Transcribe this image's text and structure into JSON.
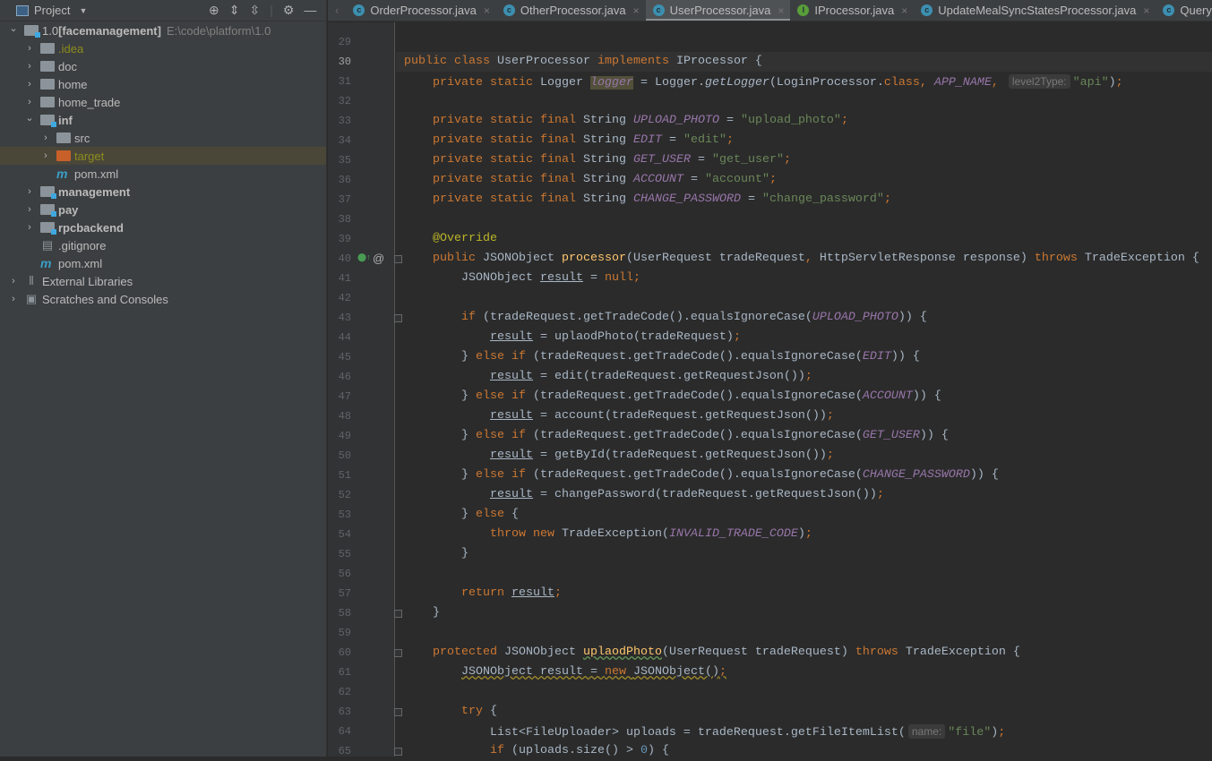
{
  "sidebar": {
    "title": "Project",
    "tree": [
      {
        "label": "1.0",
        "module": "[facemanagement]",
        "path": "E:\\code\\platform\\1.0",
        "depth": 0,
        "open": true,
        "icon": "module-folder"
      },
      {
        "label": ".idea",
        "depth": 1,
        "icon": "folder",
        "style": "olive"
      },
      {
        "label": "doc",
        "depth": 1,
        "icon": "folder"
      },
      {
        "label": "home",
        "depth": 1,
        "icon": "folder"
      },
      {
        "label": "home_trade",
        "depth": 1,
        "icon": "folder"
      },
      {
        "label": "inf",
        "depth": 1,
        "open": true,
        "icon": "module-folder",
        "style": "bold"
      },
      {
        "label": "src",
        "depth": 2,
        "icon": "folder"
      },
      {
        "label": "target",
        "depth": 2,
        "icon": "excluded-folder",
        "style": "olive",
        "selected": true
      },
      {
        "label": "pom.xml",
        "depth": 2,
        "icon": "maven",
        "leaf": true
      },
      {
        "label": "management",
        "depth": 1,
        "icon": "module-folder",
        "style": "bold"
      },
      {
        "label": "pay",
        "depth": 1,
        "icon": "module-folder",
        "style": "bold"
      },
      {
        "label": "rpcbackend",
        "depth": 1,
        "icon": "module-folder",
        "style": "bold"
      },
      {
        "label": ".gitignore",
        "depth": 1,
        "icon": "ignored-file",
        "leaf": true
      },
      {
        "label": "pom.xml",
        "depth": 1,
        "icon": "maven",
        "leaf": true
      },
      {
        "label": "External Libraries",
        "depth": 0,
        "icon": "libraries"
      },
      {
        "label": "Scratches and Consoles",
        "depth": 0,
        "icon": "scratches"
      }
    ]
  },
  "tabs": [
    {
      "label": "OrderProcessor.java",
      "icon": "class"
    },
    {
      "label": "OtherProcessor.java",
      "icon": "class"
    },
    {
      "label": "UserProcessor.java",
      "icon": "class",
      "active": true
    },
    {
      "label": "IProcessor.java",
      "icon": "interface"
    },
    {
      "label": "UpdateMealSyncStatesProcessor.java",
      "icon": "class"
    },
    {
      "label": "QueryT",
      "icon": "class"
    }
  ],
  "editor": {
    "first_line": 29,
    "current_line": 30,
    "lines": [
      [],
      [
        [
          "k",
          "public class "
        ],
        [
          "p",
          "UserProcessor "
        ],
        [
          "k",
          "implements "
        ],
        [
          "p",
          "IProcessor {"
        ]
      ],
      [
        [
          "k",
          "    private static "
        ],
        [
          "p",
          "Logger "
        ],
        [
          "c",
          "logger",
          "hl"
        ],
        [
          "p",
          " = Logger."
        ],
        [
          "f",
          "getLogger"
        ],
        [
          "p",
          "(LoginProcessor."
        ],
        [
          "k",
          "class, "
        ],
        [
          "c",
          "APP_NAME"
        ],
        [
          "k",
          ", "
        ],
        [
          "h",
          "level2Type:"
        ],
        [
          "s",
          "\"api\""
        ],
        [
          "p",
          ")"
        ],
        [
          "k",
          ";"
        ]
      ],
      [],
      [
        [
          "k",
          "    private static final "
        ],
        [
          "p",
          "String "
        ],
        [
          "c",
          "UPLOAD_PHOTO"
        ],
        [
          "p",
          " = "
        ],
        [
          "s",
          "\"upload_photo\""
        ],
        [
          "k",
          ";"
        ]
      ],
      [
        [
          "k",
          "    private static final "
        ],
        [
          "p",
          "String "
        ],
        [
          "c",
          "EDIT"
        ],
        [
          "p",
          " = "
        ],
        [
          "s",
          "\"edit\""
        ],
        [
          "k",
          ";"
        ]
      ],
      [
        [
          "k",
          "    private static final "
        ],
        [
          "p",
          "String "
        ],
        [
          "c",
          "GET_USER"
        ],
        [
          "p",
          " = "
        ],
        [
          "s",
          "\"get_user\""
        ],
        [
          "k",
          ";"
        ]
      ],
      [
        [
          "k",
          "    private static final "
        ],
        [
          "p",
          "String "
        ],
        [
          "c",
          "ACCOUNT"
        ],
        [
          "p",
          " = "
        ],
        [
          "s",
          "\"account\""
        ],
        [
          "k",
          ";"
        ]
      ],
      [
        [
          "k",
          "    private static final "
        ],
        [
          "p",
          "String "
        ],
        [
          "c",
          "CHANGE_PASSWORD"
        ],
        [
          "p",
          " = "
        ],
        [
          "s",
          "\"change_password\""
        ],
        [
          "k",
          ";"
        ]
      ],
      [],
      [
        [
          "a",
          "    @Override"
        ]
      ],
      [
        [
          "k",
          "    public "
        ],
        [
          "p",
          "JSONObject "
        ],
        [
          "m",
          "processor"
        ],
        [
          "p",
          "(UserRequest tradeRequest"
        ],
        [
          "k",
          ", "
        ],
        [
          "p",
          "HttpServletResponse response) "
        ],
        [
          "k",
          "throws "
        ],
        [
          "p",
          "TradeException {"
        ]
      ],
      [
        [
          "p",
          "        JSONObject "
        ],
        [
          "u",
          "result"
        ],
        [
          "p",
          " = "
        ],
        [
          "k",
          "null;"
        ]
      ],
      [],
      [
        [
          "k",
          "        if "
        ],
        [
          "p",
          "(tradeRequest.getTradeCode().equalsIgnoreCase("
        ],
        [
          "c",
          "UPLOAD_PHOTO"
        ],
        [
          "p",
          ")) {"
        ]
      ],
      [
        [
          "p",
          "            "
        ],
        [
          "u",
          "result"
        ],
        [
          "p",
          " = uplaodPhoto(tradeRequest)"
        ],
        [
          "k",
          ";"
        ]
      ],
      [
        [
          "p",
          "        } "
        ],
        [
          "k",
          "else if "
        ],
        [
          "p",
          "(tradeRequest.getTradeCode().equalsIgnoreCase("
        ],
        [
          "c",
          "EDIT"
        ],
        [
          "p",
          ")) {"
        ]
      ],
      [
        [
          "p",
          "            "
        ],
        [
          "u",
          "result"
        ],
        [
          "p",
          " = edit(tradeRequest.getRequestJson())"
        ],
        [
          "k",
          ";"
        ]
      ],
      [
        [
          "p",
          "        } "
        ],
        [
          "k",
          "else if "
        ],
        [
          "p",
          "(tradeRequest.getTradeCode().equalsIgnoreCase("
        ],
        [
          "c",
          "ACCOUNT"
        ],
        [
          "p",
          ")) {"
        ]
      ],
      [
        [
          "p",
          "            "
        ],
        [
          "u",
          "result"
        ],
        [
          "p",
          " = account(tradeRequest.getRequestJson())"
        ],
        [
          "k",
          ";"
        ]
      ],
      [
        [
          "p",
          "        } "
        ],
        [
          "k",
          "else if "
        ],
        [
          "p",
          "(tradeRequest.getTradeCode().equalsIgnoreCase("
        ],
        [
          "c",
          "GET_USER"
        ],
        [
          "p",
          ")) {"
        ]
      ],
      [
        [
          "p",
          "            "
        ],
        [
          "u",
          "result"
        ],
        [
          "p",
          " = getById(tradeRequest.getRequestJson())"
        ],
        [
          "k",
          ";"
        ]
      ],
      [
        [
          "p",
          "        } "
        ],
        [
          "k",
          "else if "
        ],
        [
          "p",
          "(tradeRequest.getTradeCode().equalsIgnoreCase("
        ],
        [
          "c",
          "CHANGE_PASSWORD"
        ],
        [
          "p",
          ")) {"
        ]
      ],
      [
        [
          "p",
          "            "
        ],
        [
          "u",
          "result"
        ],
        [
          "p",
          " = changePassword(tradeRequest.getRequestJson())"
        ],
        [
          "k",
          ";"
        ]
      ],
      [
        [
          "p",
          "        } "
        ],
        [
          "k",
          "else "
        ],
        [
          "p",
          "{"
        ]
      ],
      [
        [
          "k",
          "            throw new "
        ],
        [
          "p",
          "TradeException("
        ],
        [
          "c",
          "INVALID_TRADE_CODE"
        ],
        [
          "p",
          ")"
        ],
        [
          "k",
          ";"
        ]
      ],
      [
        [
          "p",
          "        }"
        ]
      ],
      [],
      [
        [
          "k",
          "        return "
        ],
        [
          "u",
          "result"
        ],
        [
          "k",
          ";"
        ]
      ],
      [
        [
          "p",
          "    }"
        ]
      ],
      [],
      [
        [
          "k",
          "    protected "
        ],
        [
          "p",
          "JSONObject "
        ],
        [
          "m",
          "uplaodPhoto",
          "typo"
        ],
        [
          "p",
          "(UserRequest tradeRequest) "
        ],
        [
          "k",
          "throws "
        ],
        [
          "p",
          "TradeException {"
        ]
      ],
      [
        [
          "p",
          "        "
        ],
        [
          "p",
          "JSONObject result = ",
          "warn"
        ],
        [
          "k",
          "new ",
          "warn"
        ],
        [
          "p",
          "JSONObject()",
          "warn"
        ],
        [
          "k",
          ";",
          "warn"
        ]
      ],
      [],
      [
        [
          "k",
          "        try "
        ],
        [
          "p",
          "{"
        ]
      ],
      [
        [
          "p",
          "            List<FileUploader> uploads = tradeRequest.getFileItemList("
        ],
        [
          "h",
          "name:"
        ],
        [
          "s",
          "\"file\""
        ],
        [
          "p",
          ")"
        ],
        [
          "k",
          ";"
        ]
      ],
      [
        [
          "k",
          "            if "
        ],
        [
          "p",
          "(uploads.size() > "
        ],
        [
          "n",
          "0"
        ],
        [
          "p",
          ") {"
        ]
      ]
    ]
  },
  "colors": {
    "keyword": "#CC7832",
    "string": "#6A8759",
    "constant": "#9876AA",
    "annotation": "#BBB529",
    "number": "#6897BB",
    "method": "#FFC66D",
    "text": "#A9B7C6",
    "background": "#2B2B2B"
  }
}
